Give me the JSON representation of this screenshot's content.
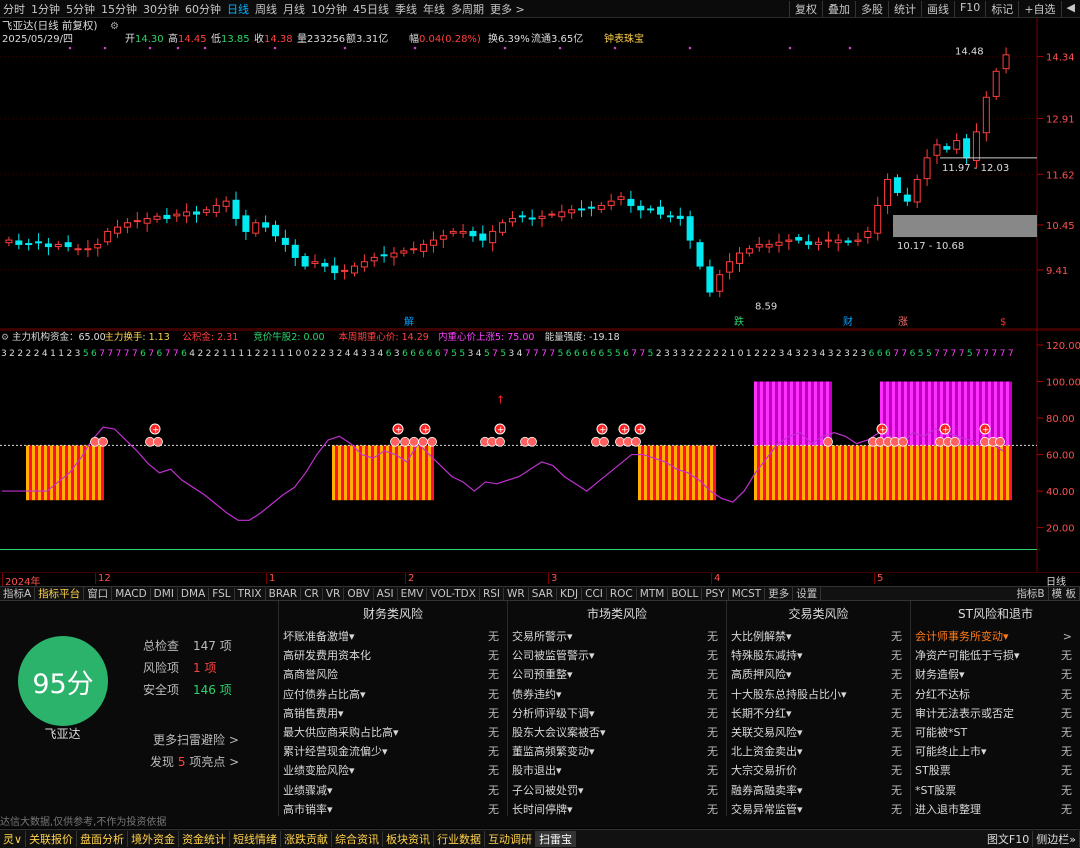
{
  "topbar": {
    "items": [
      "分时",
      "1分钟",
      "5分钟",
      "15分钟",
      "30分钟",
      "60分钟",
      "日线",
      "周线",
      "月线",
      "10分钟",
      "45日线",
      "季线",
      "年线",
      "多周期",
      "更多 >"
    ],
    "active": "日线",
    "right": [
      "复权",
      "叠加",
      "多股",
      "统计",
      "画线",
      "F10",
      "标记",
      "+自选",
      "◀"
    ]
  },
  "stock": {
    "title": "飞亚达(日线 前复权)",
    "date": "2025/05/29/四",
    "open_l": "开",
    "open": "14.30",
    "high_l": "高",
    "high": "14.45",
    "low_l": "低",
    "low": "13.85",
    "close_l": "收",
    "close": "14.38",
    "vol_l": "量",
    "vol": "233256",
    "amt_l": "额",
    "amt": "3.31亿",
    "chg_l": "幅",
    "chg": "0.04(0.28%)",
    "turn_l": "换",
    "turn": "6.39%",
    "float_l": "流通",
    "float": "3.65亿",
    "tool": "钟表珠宝"
  },
  "price_axis": [
    "14.34",
    "12.91",
    "11.62",
    "10.45",
    "9.41"
  ],
  "annotations": {
    "high": "14.48",
    "mid": "11.97 - 12.03",
    "low_zone": "10.17 - 10.68",
    "bottom": "8.59"
  },
  "markers": [
    "解",
    "跌",
    "财",
    "涨",
    "$"
  ],
  "chart_data": {
    "type": "candlestick",
    "series": [
      {
        "name": "飞亚达",
        "values": [
          10.1,
          10.0,
          10.0,
          10.05,
          9.95,
          10.0,
          9.95,
          9.9,
          9.9,
          10.0,
          10.3,
          10.4,
          10.5,
          10.55,
          10.6,
          10.65,
          10.6,
          10.7,
          10.75,
          10.7,
          10.8,
          10.9,
          11.0,
          10.6,
          10.3,
          10.5,
          10.4,
          10.2,
          10.0,
          9.7,
          9.5,
          9.6,
          9.5,
          9.35,
          9.4,
          9.5,
          9.6,
          9.7,
          9.75,
          9.8,
          9.85,
          9.9,
          10.0,
          10.1,
          10.2,
          10.3,
          10.3,
          10.2,
          10.1,
          10.3,
          10.5,
          10.6,
          10.65,
          10.6,
          10.65,
          10.7,
          10.75,
          10.8,
          10.8,
          10.85,
          10.9,
          11.0,
          11.1,
          10.9,
          10.8,
          10.8,
          10.7,
          10.65,
          10.6,
          10.1,
          9.5,
          8.9,
          9.3,
          9.6,
          9.8,
          9.9,
          10.0,
          10.0,
          10.05,
          10.1,
          10.1,
          10.0,
          10.05,
          10.1,
          10.1,
          10.05,
          10.1,
          10.3,
          10.9,
          11.5,
          11.2,
          11.0,
          11.5,
          12.0,
          12.3,
          12.2,
          12.4,
          12.0,
          12.6,
          13.4,
          14.0,
          14.38
        ]
      }
    ]
  },
  "ind_title": {
    "a": "主力机构资金：65.00",
    "b": "主力换手: 1.13",
    "c": "公积金: 2.31",
    "d": "竞价牛股2: 0.00",
    "e": "本周期重心价: 14.29",
    "f": "内重心价上涨5: 75.00",
    "g": "能量强度: -19.18"
  },
  "ind_axis": [
    "120.00",
    "100.00",
    "80.00",
    "60.00",
    "40.00",
    "20.00"
  ],
  "digits": "3222241123567777767677642221111221110022324433463666667553457534777756666655677523332222210122234323432323666776557777577777",
  "dates": [
    "2024年",
    "12",
    "1",
    "2",
    "3",
    "4",
    "5"
  ],
  "date_right": "日线",
  "ind_tabs": [
    "指标A",
    "指标平台",
    "窗口",
    "MACD",
    "DMI",
    "DMA",
    "FSL",
    "TRIX",
    "BRAR",
    "CR",
    "VR",
    "OBV",
    "ASI",
    "EMV",
    "VOL-TDX",
    "RSI",
    "WR",
    "SAR",
    "KDJ",
    "CCI",
    "ROC",
    "MTM",
    "BOLL",
    "PSY",
    "MCST",
    "更多",
    "设置"
  ],
  "ind_tabs_active": "指标平台",
  "ind_tabs_right": [
    "指标B",
    "模 板"
  ],
  "scan": {
    "score": "95分",
    "name": "飞亚达",
    "total_l": "总检查",
    "total": "147 项",
    "risk_l": "风险项",
    "risk": "1 项",
    "safe_l": "安全项",
    "safe": "146 项",
    "more": "更多扫雷避险 >",
    "found_a": "发现",
    "found_n": "5",
    "found_b": "项亮点 >",
    "disclaimer": "达信大数据,仅供参考,不作为投资依据"
  },
  "columns": [
    {
      "title": "财务类风险",
      "rows": [
        [
          "坏账准备激增▾",
          "无"
        ],
        [
          "高研发费用资本化",
          "无"
        ],
        [
          "高商誉风险",
          "无"
        ],
        [
          "应付债券占比高▾",
          "无"
        ],
        [
          "高销售费用▾",
          "无"
        ],
        [
          "最大供应商采购占比高▾",
          "无"
        ],
        [
          "累计经营现金流偏少▾",
          "无"
        ],
        [
          "业绩变脸风险▾",
          "无"
        ],
        [
          "业绩骤减▾",
          "无"
        ],
        [
          "高市销率▾",
          "无"
        ]
      ]
    },
    {
      "title": "市场类风险",
      "rows": [
        [
          "交易所警示▾",
          "无"
        ],
        [
          "公司被监管警示▾",
          "无"
        ],
        [
          "公司预重整▾",
          "无"
        ],
        [
          "债券违约▾",
          "无"
        ],
        [
          "分析师评级下调▾",
          "无"
        ],
        [
          "股东大会议案被否▾",
          "无"
        ],
        [
          "董监高频繁变动▾",
          "无"
        ],
        [
          "股市退出▾",
          "无"
        ],
        [
          "子公司被处罚▾",
          "无"
        ],
        [
          "长时间停牌▾",
          "无"
        ]
      ]
    },
    {
      "title": "交易类风险",
      "rows": [
        [
          "大比例解禁▾",
          "无"
        ],
        [
          "特殊股东减持▾",
          "无"
        ],
        [
          "高质押风险▾",
          "无"
        ],
        [
          "十大股东总持股占比小▾",
          "无"
        ],
        [
          "长期不分红▾",
          "无"
        ],
        [
          "关联交易风险▾",
          "无"
        ],
        [
          "北上资金卖出▾",
          "无"
        ],
        [
          "大宗交易折价",
          "无"
        ],
        [
          "融券高融卖率▾",
          "无"
        ],
        [
          "交易异常监管▾",
          "无"
        ]
      ]
    },
    {
      "title": "ST风险和退市",
      "rows": [
        [
          "会计师事务所变动▾",
          ">"
        ],
        [
          "净资产可能低于亏损▾",
          "无"
        ],
        [
          "财务造假▾",
          "无"
        ],
        [
          "分红不达标",
          "无"
        ],
        [
          "审计无法表示或否定",
          "无"
        ],
        [
          "可能被*ST",
          "无"
        ],
        [
          "可能终止上市▾",
          "无"
        ],
        [
          "ST股票",
          "无"
        ],
        [
          "*ST股票",
          "无"
        ],
        [
          "进入退市整理",
          "无"
        ]
      ]
    }
  ],
  "bottom": [
    "灵∨",
    "关联报价",
    "盘面分析",
    "境外资金",
    "资金统计",
    "短线情绪",
    "涨跌贡献",
    "综合资讯",
    "板块资讯",
    "行业数据",
    "互动调研",
    "扫雷宝"
  ],
  "bottom_active": "扫雷宝",
  "bottom_right": [
    "图文F10",
    "侧边栏»"
  ]
}
